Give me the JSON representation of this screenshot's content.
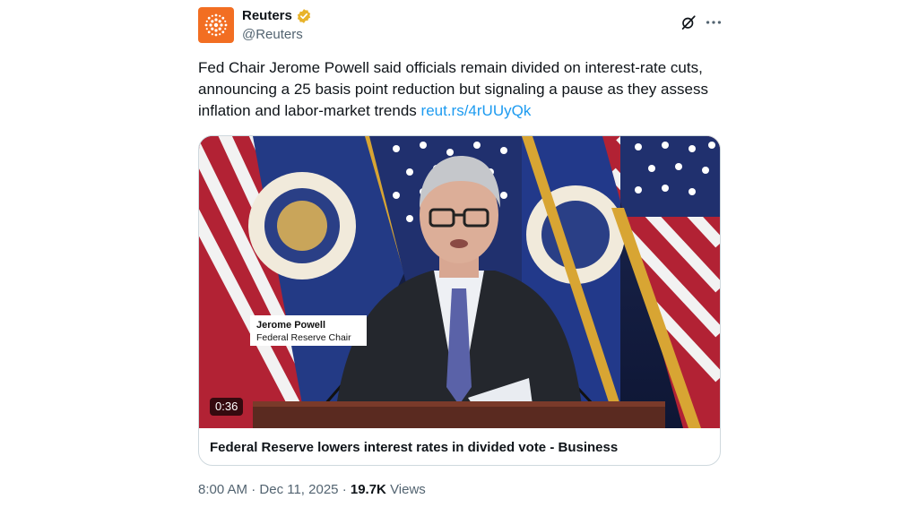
{
  "author": {
    "name": "Reuters",
    "handle": "@Reuters",
    "verified": true,
    "avatar_icon": "reuters-logo",
    "brand_color": "#f26e22",
    "badge_color": "#e8b32a"
  },
  "actions": {
    "grok_icon": "grok-icon",
    "more_icon": "more-icon"
  },
  "tweet": {
    "text": "Fed Chair Jerome Powell said officials remain divided on interest-rate cuts, announcing a 25 basis point reduction but signaling a pause as they assess inflation and labor-market trends",
    "link": "reut.rs/4rUUyQk",
    "link_color": "#1d9bf0"
  },
  "media": {
    "lower_third_name": "Jerome Powell",
    "lower_third_title": "Federal Reserve Chair",
    "duration": "0:36",
    "card_title": "Federal Reserve lowers interest rates in divided vote - Business"
  },
  "meta": {
    "time": "8:00 AM",
    "separator": "·",
    "date": "Dec 11, 2025",
    "views_count": "19.7K",
    "views_label": "Views"
  }
}
